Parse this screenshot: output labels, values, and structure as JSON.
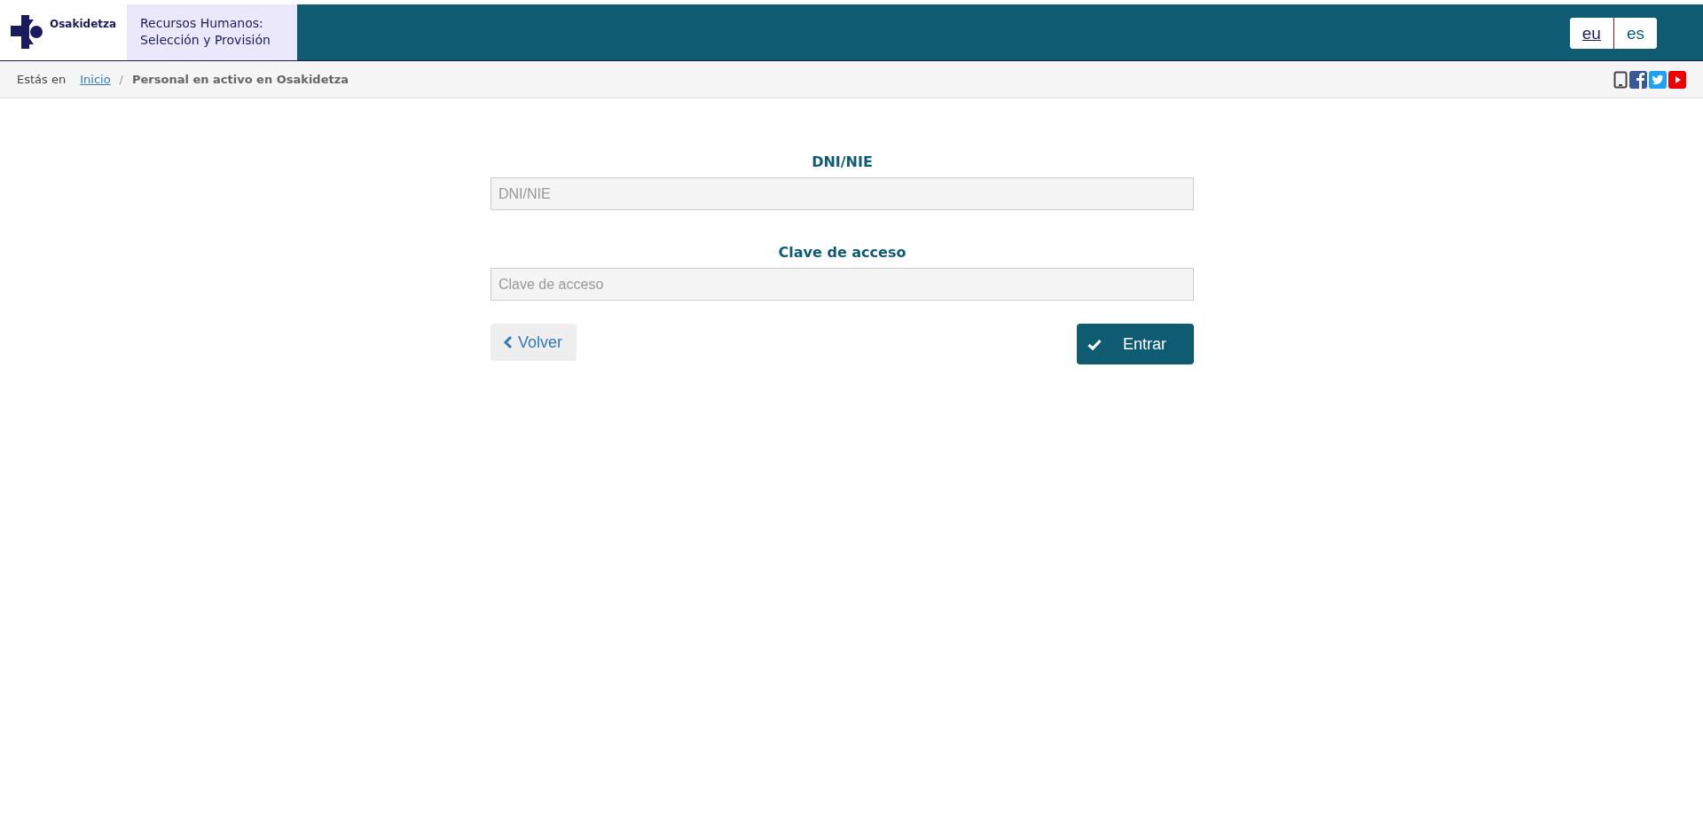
{
  "header": {
    "brand": "Osakidetza",
    "title_line_1": "Recursos Humanos:",
    "title_line_2": "Selección y Provisión",
    "languages": [
      {
        "label": "eu",
        "selected": false
      },
      {
        "label": "es",
        "selected": true
      }
    ]
  },
  "breadcrumb": {
    "prefix": "Estás en",
    "items": [
      {
        "label": "Inicio",
        "kind": "link"
      },
      {
        "label": "Personal en activo en Osakidetza",
        "kind": "current"
      }
    ],
    "separator": "/"
  },
  "form": {
    "fields": [
      {
        "label": "DNI/NIE",
        "placeholder": "DNI/NIE"
      },
      {
        "label": "Clave de acceso",
        "placeholder": "Clave de acceso"
      }
    ],
    "back_button": "Volver",
    "submit_button": "Entrar"
  }
}
